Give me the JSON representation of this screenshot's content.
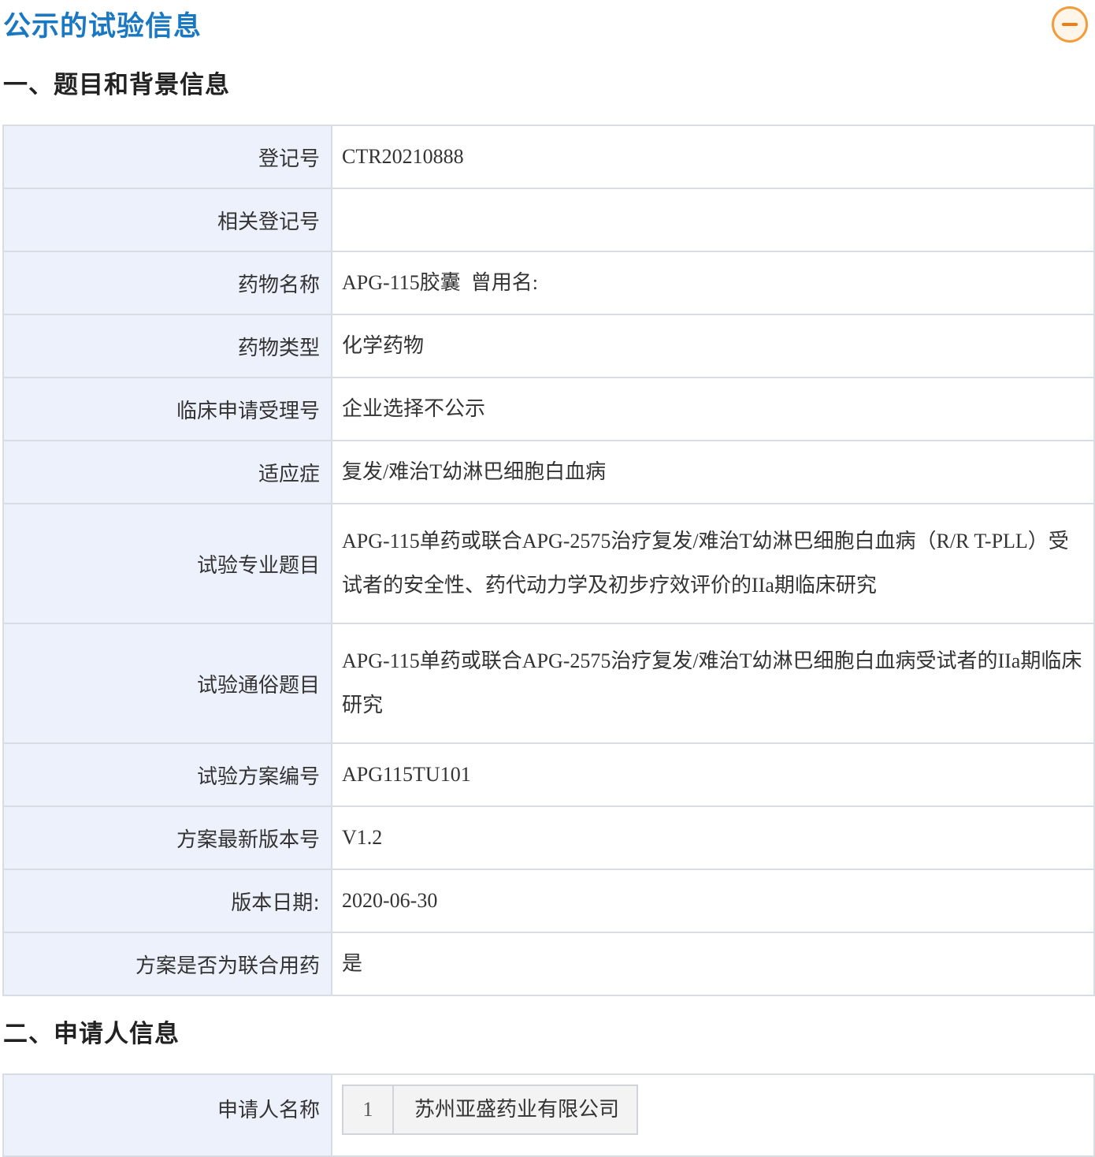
{
  "header": {
    "title": "公示的试验信息",
    "collapse_icon": "minus-circle-icon"
  },
  "section1": {
    "title": "一、题目和背景信息",
    "rows": [
      {
        "label": "登记号",
        "value": "CTR20210888"
      },
      {
        "label": "相关登记号",
        "value": ""
      },
      {
        "label": "药物名称",
        "value": "APG-115胶囊  曾用名:"
      },
      {
        "label": "药物类型",
        "value": "化学药物"
      },
      {
        "label": "临床申请受理号",
        "value": "企业选择不公示"
      },
      {
        "label": "适应症",
        "value": "复发/难治T幼淋巴细胞白血病"
      },
      {
        "label": "试验专业题目",
        "value": "APG-115单药或联合APG-2575治疗复发/难治T幼淋巴细胞白血病（R/R T-PLL）受试者的安全性、药代动力学及初步疗效评价的IIa期临床研究"
      },
      {
        "label": "试验通俗题目",
        "value": "APG-115单药或联合APG-2575治疗复发/难治T幼淋巴细胞白血病受试者的IIa期临床研究"
      },
      {
        "label": "试验方案编号",
        "value": "APG115TU101"
      },
      {
        "label": "方案最新版本号",
        "value": "V1.2"
      },
      {
        "label": "版本日期:",
        "value": "2020-06-30"
      },
      {
        "label": "方案是否为联合用药",
        "value": "是"
      }
    ]
  },
  "section2": {
    "title": "二、申请人信息",
    "applicant_label": "申请人名称",
    "applicant_index": "1",
    "applicant_name": "苏州亚盛药业有限公司"
  },
  "colors": {
    "title_blue": "#1a78c2",
    "accent_orange": "#ee7d13",
    "label_bg": "#edf1fb",
    "border": "#d8dde4"
  }
}
